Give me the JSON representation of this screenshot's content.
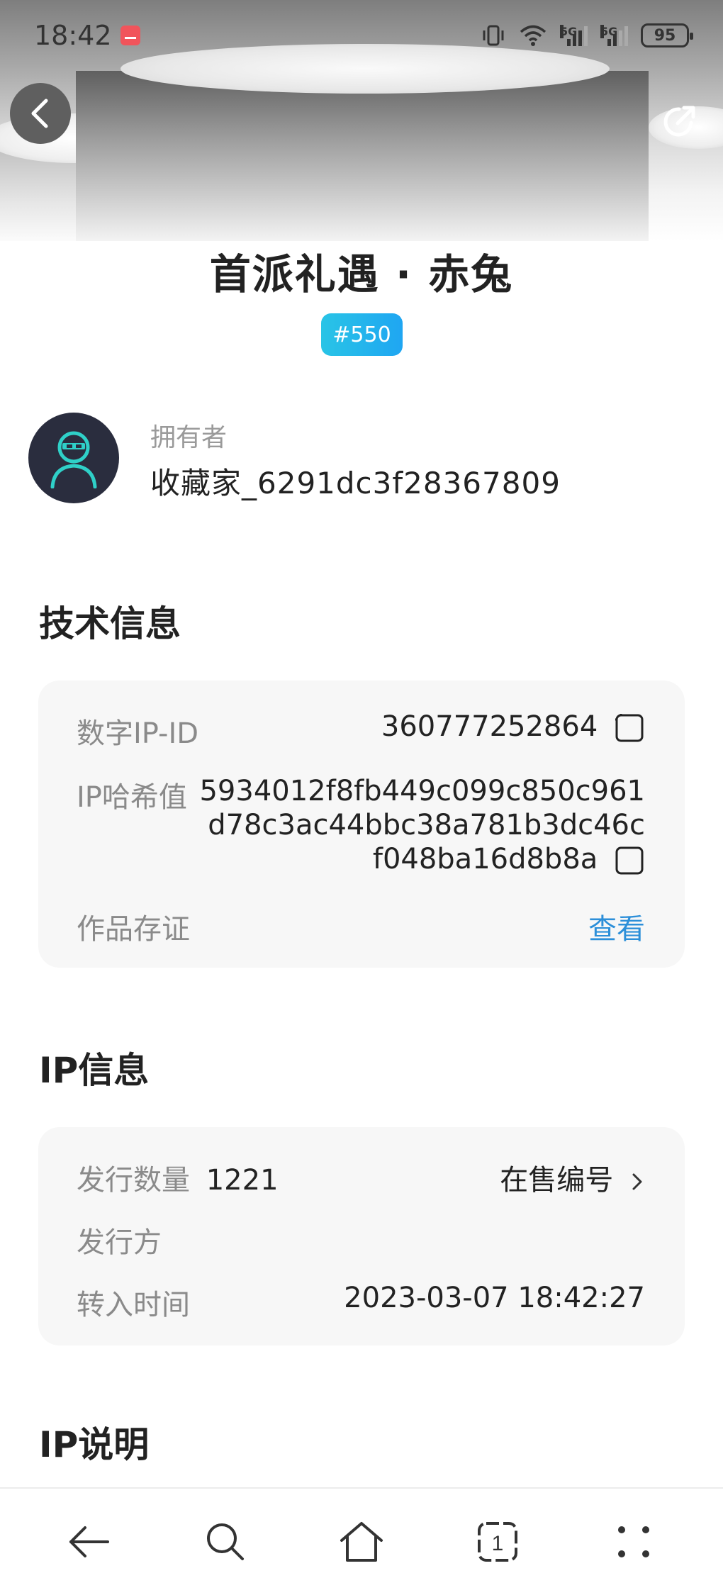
{
  "status_bar": {
    "time": "18:42",
    "battery": "95",
    "network_1": "5G",
    "network_2": "5G"
  },
  "header": {
    "title": "首派礼遇 · 赤兔",
    "badge": "#550"
  },
  "owner": {
    "label": "拥有者",
    "name": "收藏家_6291dc3f28367809"
  },
  "tech_info": {
    "section_title": "技术信息",
    "digital_ip_id_label": "数字IP-ID",
    "digital_ip_id_value": "360777252864",
    "ip_hash_label": "IP哈希值",
    "ip_hash_value": "5934012f8fb449c099c850c961d78c3ac44bbc38a781b3dc46cf048ba16d8b8a",
    "certificate_label": "作品存证",
    "certificate_link": "查看"
  },
  "ip_info": {
    "section_title": "IP信息",
    "issue_count_label": "发行数量",
    "issue_count_value": "1221",
    "on_sale_label": "在售编号",
    "issuer_label": "发行方",
    "transfer_time_label": "转入时间",
    "transfer_time_value": "2023-03-07 18:42:27"
  },
  "ip_desc": {
    "section_title": "IP说明"
  },
  "colors": {
    "accent_link": "#2c8fd9",
    "badge_start": "#29c4e6",
    "badge_end": "#1fa6f2",
    "avatar_bg": "#2a2d3e",
    "avatar_figure": "#2fd0c8",
    "card_bg": "#f7f7f7"
  },
  "icons": {
    "back": "chevron-left-icon",
    "share": "share-icon",
    "copy": "copy-icon",
    "chevron_right": "chevron-right-icon",
    "nav_back": "arrow-left-icon",
    "nav_search": "search-icon",
    "nav_home": "home-icon",
    "nav_tabs": "tabs-icon",
    "nav_menu": "menu-dots-icon"
  },
  "bottom_nav": {
    "tabs_count": "1"
  }
}
